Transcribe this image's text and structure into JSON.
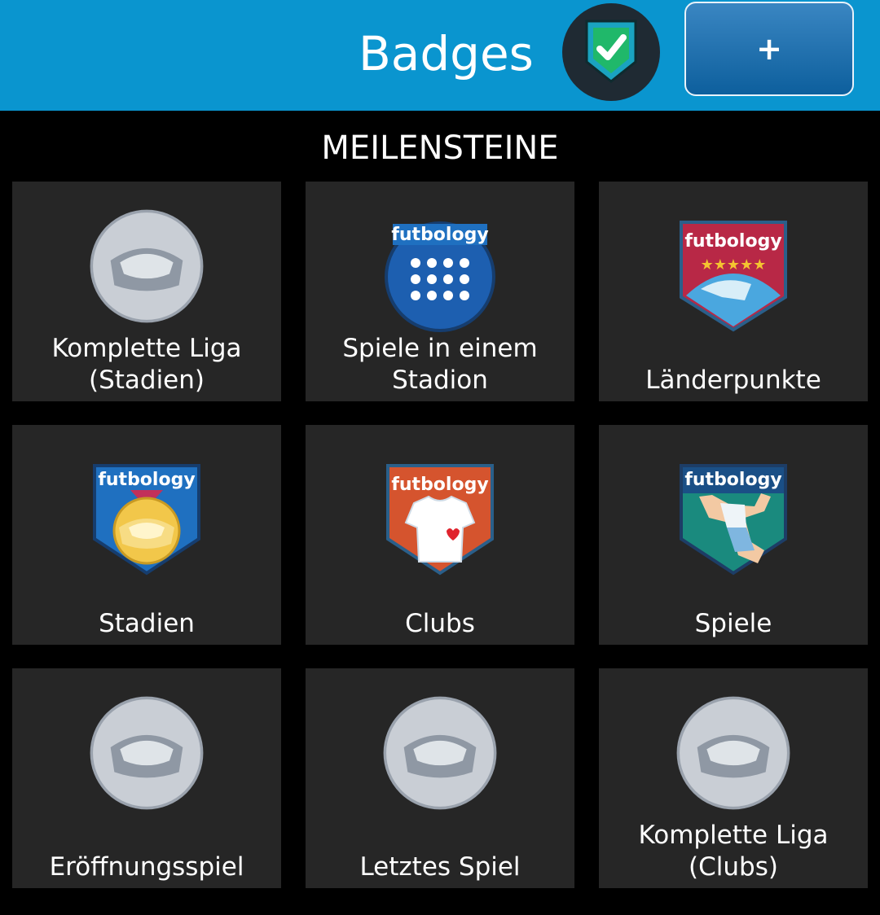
{
  "header": {
    "title": "Badges",
    "add_label": "+",
    "status_icon": "shield-check-icon",
    "color": "#0a95cf"
  },
  "section": {
    "title": "MEILENSTEINE"
  },
  "tiles": [
    {
      "label": "Komplette Liga\n(Stadien)",
      "icon": "stadium-placeholder-icon",
      "earned": false
    },
    {
      "label": "Spiele in einem\nStadion",
      "icon": "floodlight-badge-icon",
      "earned": true,
      "brand": "futbology"
    },
    {
      "label": "Länderpunkte",
      "icon": "globe-badge-icon",
      "earned": true,
      "brand": "futbology"
    },
    {
      "label": "Stadien",
      "icon": "stadium-medal-badge-icon",
      "earned": true,
      "brand": "futbology"
    },
    {
      "label": "Clubs",
      "icon": "jersey-badge-icon",
      "earned": true,
      "brand": "futbology"
    },
    {
      "label": "Spiele",
      "icon": "celebration-badge-icon",
      "earned": true,
      "brand": "futbology"
    },
    {
      "label": "Eröffnungsspiel",
      "icon": "stadium-placeholder-icon",
      "earned": false
    },
    {
      "label": "Letztes Spiel",
      "icon": "stadium-placeholder-icon",
      "earned": false
    },
    {
      "label": "Komplette Liga\n(Clubs)",
      "icon": "stadium-placeholder-icon",
      "earned": false
    }
  ]
}
